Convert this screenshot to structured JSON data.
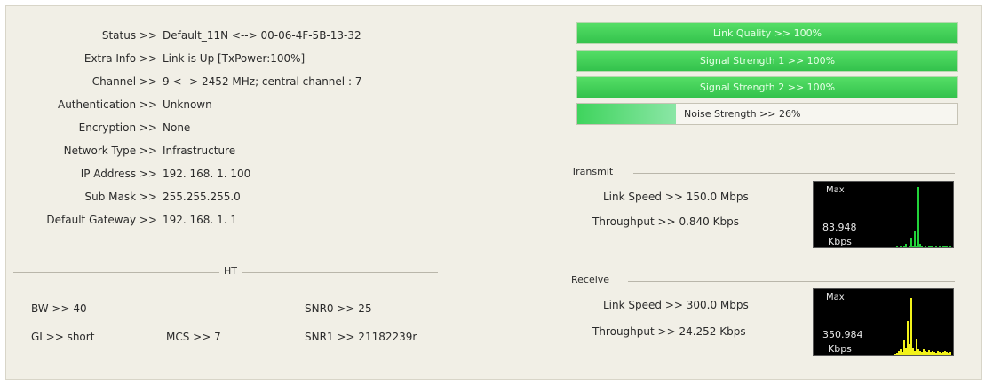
{
  "status": {
    "rows": [
      {
        "label": "Status >>",
        "value": "Default_11N <--> 00-06-4F-5B-13-32"
      },
      {
        "label": "Extra Info >>",
        "value": "Link is Up [TxPower:100%]"
      },
      {
        "label": "Channel >>",
        "value": "9 <--> 2452 MHz; central channel : 7"
      },
      {
        "label": "Authentication >>",
        "value": "Unknown"
      },
      {
        "label": "Encryption >>",
        "value": "None"
      },
      {
        "label": "Network Type >>",
        "value": "Infrastructure"
      },
      {
        "label": "IP Address >>",
        "value": "192. 168. 1. 100"
      },
      {
        "label": "Sub Mask >>",
        "value": "255.255.255.0"
      },
      {
        "label": "Default Gateway >>",
        "value": "192. 168. 1. 1"
      }
    ]
  },
  "ht": {
    "title": "HT",
    "bw": "BW >> 40",
    "gi": "GI >> short",
    "mcs": "MCS >> 7",
    "snr0": "SNR0 >> 25",
    "snr1": "SNR1 >> 21182239r"
  },
  "signal": {
    "link_quality": {
      "label": "Link Quality >> 100%",
      "level": 1.0
    },
    "signal_strength_1": {
      "label": "Signal Strength 1 >> 100%",
      "level": 1.0
    },
    "signal_strength_2": {
      "label": "Signal Strength 2 >> 100%",
      "level": 1.0
    },
    "noise_strength": {
      "label": "Noise Strength >> 26%",
      "level": 0.26
    }
  },
  "transmit": {
    "title": "Transmit",
    "link_speed": "Link Speed >> 150.0 Mbps",
    "throughput": "Throughput >> 0.840 Kbps",
    "graph_max": "Max",
    "graph_value": "83.948",
    "graph_unit": "Kbps",
    "graph_color": "#22d33a"
  },
  "receive": {
    "title": "Receive",
    "link_speed": "Link Speed >> 300.0 Mbps",
    "throughput": "Throughput >> 24.252 Kbps",
    "graph_max": "Max",
    "graph_value": "350.984",
    "graph_unit": "Kbps",
    "graph_color": "#f2f21a"
  },
  "colors": {
    "bar_green": "#3fcf55",
    "panel_bg": "#f1efe6"
  }
}
